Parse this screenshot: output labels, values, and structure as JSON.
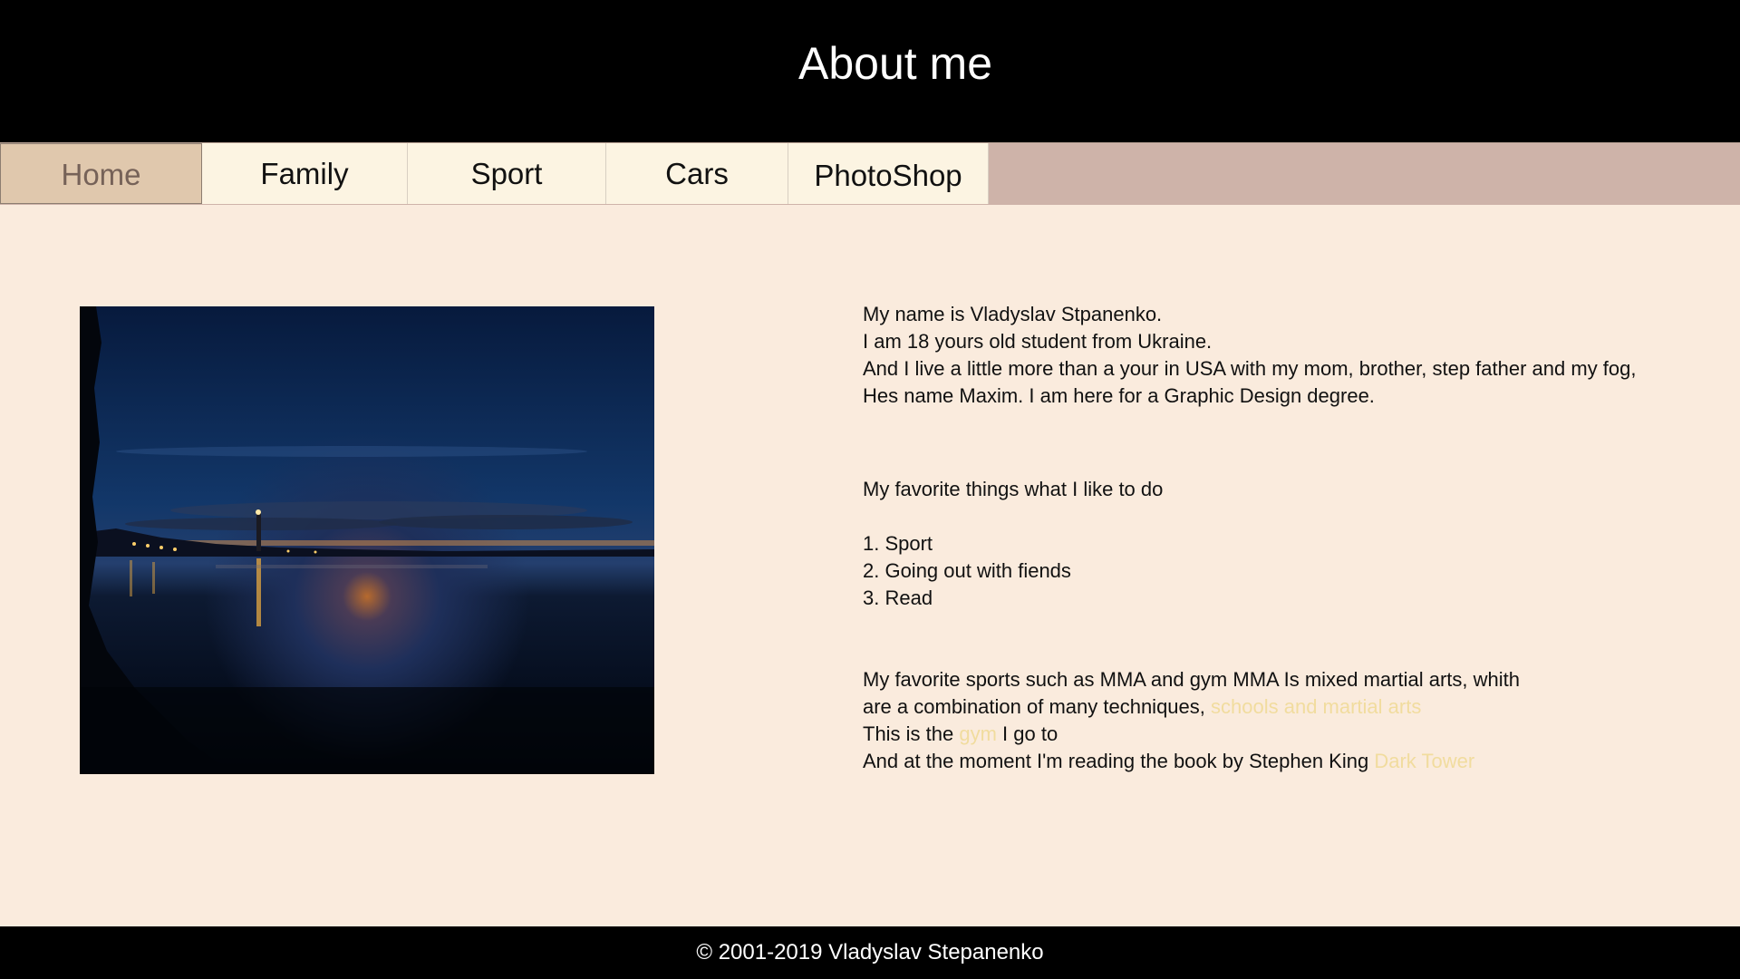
{
  "header": {
    "title": "About me"
  },
  "nav": {
    "items": [
      {
        "label": "Home",
        "active": true
      },
      {
        "label": "Family",
        "active": false
      },
      {
        "label": "Sport",
        "active": false
      },
      {
        "label": "Cars",
        "active": false
      },
      {
        "label": "PhotoShop",
        "active": false
      }
    ]
  },
  "intro": {
    "lines": [
      "My name is Vladyslav Stpanenko.",
      "I am 18 yours old student from Ukraine.",
      "And I live a little more than a your in USA with my mom, brother, step father and my fog,",
      "Hes name Maxim. I am here for a Graphic Design degree."
    ]
  },
  "favorites": {
    "heading": "My favorite things what I like to do",
    "items": [
      "1. Sport",
      "2. Going out with fiends",
      "3. Read"
    ]
  },
  "sports": {
    "line1": "My favorite sports such as MMA and gym MMA Is mixed martial arts, whith",
    "line2_text": "are a combination of many techniques, ",
    "line2_link": "schools and martial arts",
    "line3_pre": "This is the ",
    "line3_link": "gym",
    "line3_post": " I go to",
    "line4_text": "And at the moment I'm reading the book by Stephen King ",
    "line4_link": "Dark Tower"
  },
  "footer": {
    "copyright": "© 2001-2019 Vladyslav Stepanenko"
  },
  "colors": {
    "page_background": "#faebdd",
    "header_background": "#000000",
    "nav_bar": "#ceb3a9",
    "nav_active": "#e0c8ad",
    "nav_item": "#fcf4e2",
    "link": "#f1dc9e"
  }
}
